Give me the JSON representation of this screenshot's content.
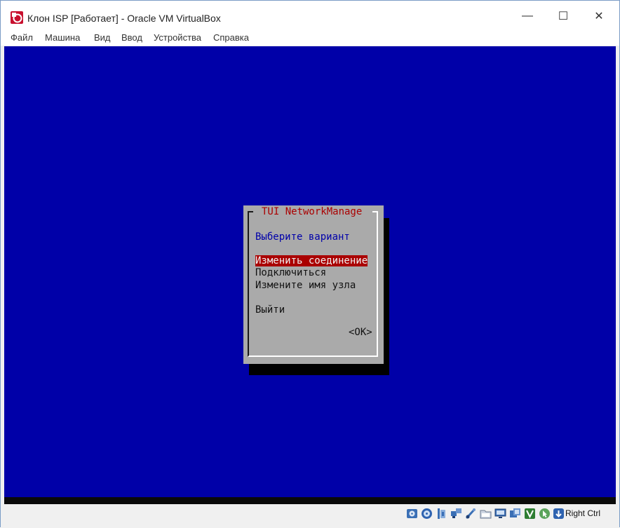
{
  "window": {
    "title": "Клон ISP [Работает] - Oracle VM VirtualBox",
    "controls": {
      "minimize": "—",
      "maximize": "☐",
      "close": "✕"
    }
  },
  "menu": {
    "items": [
      "Файл",
      "Машина",
      "Вид",
      "Ввод",
      "Устройства",
      "Справка"
    ]
  },
  "dialog": {
    "title": "TUI NetworkManage",
    "prompt": "Выберите вариант",
    "options": [
      "Изменить соединение",
      "Подключиться",
      "Измените имя узла",
      "Выйти"
    ],
    "selected_index": 0,
    "ok_label": "<OK>"
  },
  "statusbar": {
    "icons": [
      "hard-disk-icon",
      "optical-drive-icon",
      "audio-icon",
      "network-icon",
      "usb-icon",
      "shared-folders-icon",
      "display-icon",
      "video-capture-icon",
      "vt-x-icon",
      "mouse-integration-icon",
      "keyboard-capture-icon"
    ],
    "host_key": "Right Ctrl"
  },
  "colors": {
    "vm_background": "#0000a8",
    "dialog_background": "#aaaaaa",
    "dialog_title": "#aa0000",
    "prompt": "#0000aa",
    "selection": "#aa0000"
  }
}
